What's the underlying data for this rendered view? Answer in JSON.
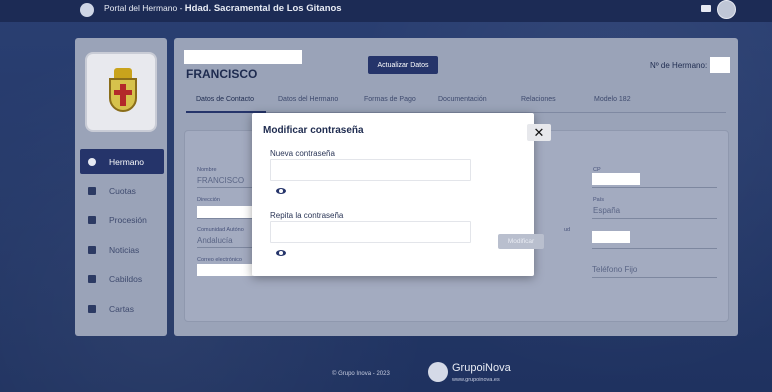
{
  "topbar": {
    "title_prefix": "Portal del Hermano - ",
    "title_main": "Hdad. Sacramental de Los Gitanos"
  },
  "sidebar": {
    "items": [
      {
        "label": "Hermano",
        "icon": "person-icon",
        "active": true
      },
      {
        "label": "Cuotas",
        "icon": "card-icon",
        "active": false
      },
      {
        "label": "Procesión",
        "icon": "cross-icon",
        "active": false
      },
      {
        "label": "Noticias",
        "icon": "newspaper-icon",
        "active": false
      },
      {
        "label": "Cabildos",
        "icon": "group-icon",
        "active": false
      },
      {
        "label": "Cartas",
        "icon": "mail-icon",
        "active": false
      }
    ]
  },
  "main": {
    "member_name": "FRANCISCO",
    "update_button": "Actualizar Datos",
    "member_number_label": "Nº de Hermano:",
    "tabs": [
      "Datos de Contacto",
      "Datos del Hermano",
      "Formas de Pago",
      "Documentación",
      "Relaciones",
      "Modelo 182"
    ],
    "active_tab": "Datos de Contacto",
    "fields": {
      "nombre_label": "Nombre",
      "nombre_value": "FRANCISCO",
      "direccion_label": "Dirección",
      "comunidad_label": "Comunidad Autóno",
      "comunidad_value": "Andalucía",
      "correo_label": "Correo electrónico",
      "cp_label": "CP",
      "pais_label": "País",
      "pais_value": "España",
      "movil_label": "ud",
      "telefono_fijo": "Teléfono Fijo"
    },
    "disabled_button": "Modificar"
  },
  "modal": {
    "title": "Modificar contraseña",
    "close_label": "✕",
    "new_password_label": "Nueva contraseña",
    "repeat_password_label": "Repita la contraseña"
  },
  "footer": {
    "copyright": "© Grupo Inova - 2023",
    "brand": "GrupoiNova",
    "url": "www.grupoinova.es"
  }
}
